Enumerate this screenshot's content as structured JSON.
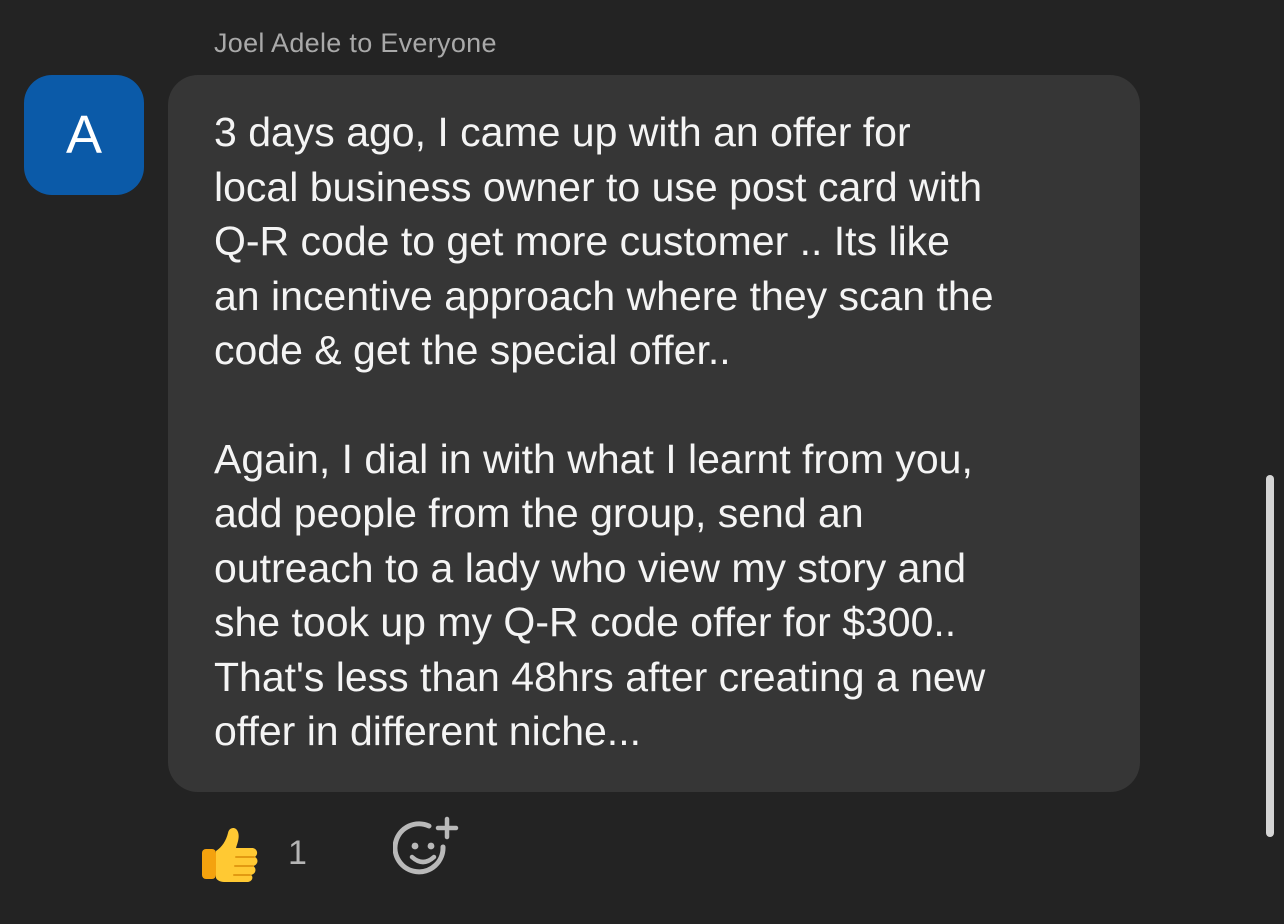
{
  "message": {
    "sender_label": "Joel Adele to Everyone",
    "avatar_initial": "A",
    "paragraphs": [
      "3 days ago,  I  came up with an offer for\nlocal business owner to use post card with\nQ-R code to get more customer ..  Its like\nan incentive approach where they scan the\ncode & get the special offer..",
      "Again,  I dial in with what I learnt from you,\nadd people from the group, send an\noutreach to a lady who view my story and\nshe took up my Q-R code offer for $300..\nThat's less than 48hrs after creating a new\noffer in different niche..."
    ]
  },
  "reactions": {
    "items": [
      {
        "icon": "thumbs-up-icon",
        "count": "1"
      }
    ],
    "add_icon": "add-reaction-icon"
  },
  "colors": {
    "background": "#232323",
    "bubble": "#363636",
    "avatar": "#0b5aa8",
    "sender_text": "#a9a9a9",
    "message_text": "#f4f4f4"
  }
}
